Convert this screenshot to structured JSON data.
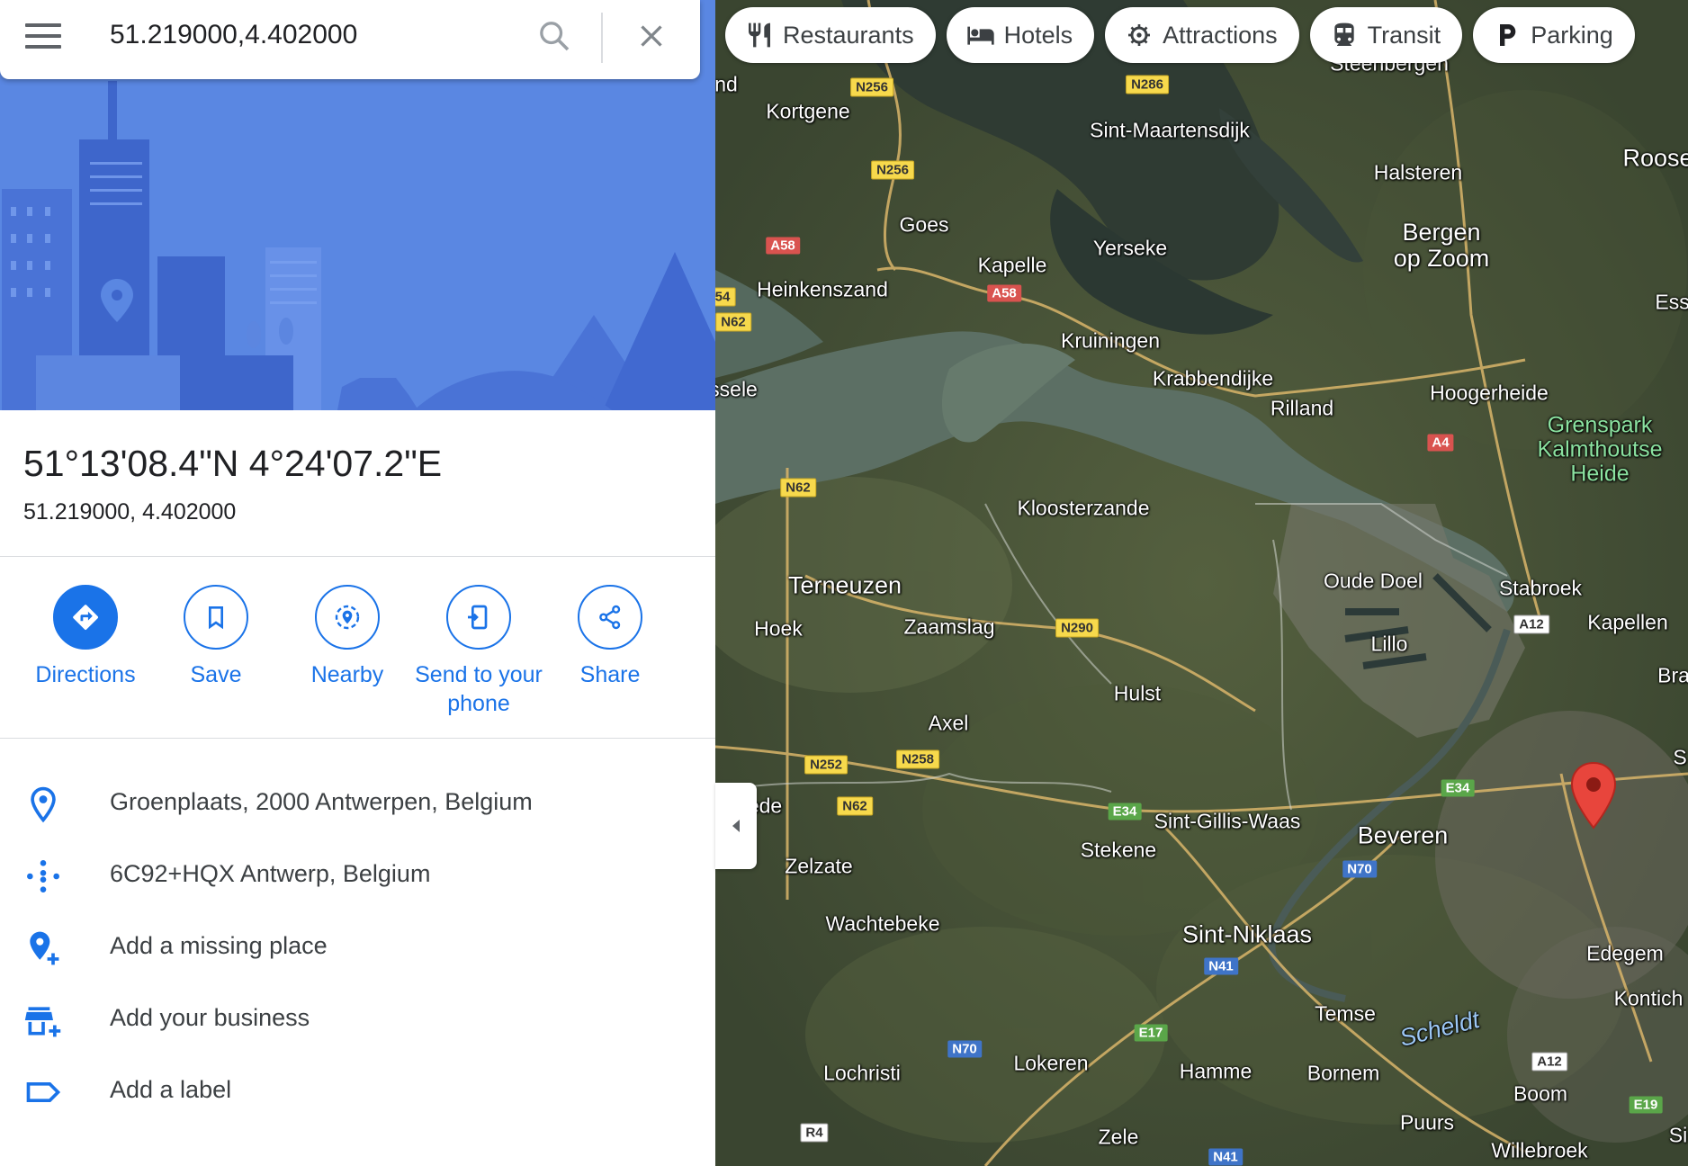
{
  "search": {
    "query": "51.219000,4.402000"
  },
  "place": {
    "title": "51°13'08.4\"N 4°24'07.2\"E",
    "decimal": "51.219000, 4.402000"
  },
  "actions": [
    {
      "label": "Directions",
      "icon": "directions-icon"
    },
    {
      "label": "Save",
      "icon": "bookmark-icon"
    },
    {
      "label": "Nearby",
      "icon": "nearby-icon"
    },
    {
      "label": "Send to your phone",
      "icon": "send-to-phone-icon"
    },
    {
      "label": "Share",
      "icon": "share-icon"
    }
  ],
  "info": [
    {
      "text": "Groenplaats, 2000 Antwerpen, Belgium",
      "icon": "location-pin-icon"
    },
    {
      "text": "6C92+HQX Antwerp, Belgium",
      "icon": "plus-code-icon"
    },
    {
      "text": "Add a missing place",
      "icon": "add-place-icon"
    },
    {
      "text": "Add your business",
      "icon": "add-business-icon"
    },
    {
      "text": "Add a label",
      "icon": "label-icon"
    }
  ],
  "chips": [
    {
      "label": "Restaurants",
      "icon": "restaurant-icon"
    },
    {
      "label": "Hotels",
      "icon": "hotel-icon"
    },
    {
      "label": "Attractions",
      "icon": "attractions-icon"
    },
    {
      "label": "Transit",
      "icon": "transit-icon"
    },
    {
      "label": "Parking",
      "icon": "parking-icon"
    }
  ],
  "colors": {
    "accent": "#1a73e8",
    "hero": "#5a87e2",
    "marker": "#d93025"
  },
  "map": {
    "places": [
      "Kortgene",
      "Sint-Maartensdijk",
      "Halsteren",
      "Roosen",
      "Goes",
      "Yerseke",
      "Bergen op Zoom",
      "Kapelle",
      "Heinkenszand",
      "Esse",
      "Kruiningen",
      "Krabbendijke",
      "Rilland",
      "Hoogerheide",
      "Grenspark Kalmthoutse Heide",
      "ssele",
      "Kloosterzande",
      "Terneuzen",
      "Oude Doel",
      "Stabroek",
      "Hoek",
      "Zaamslag",
      "Lillo",
      "Kapellen",
      "Bra",
      "Hulst",
      "Axel",
      "ede",
      "Sint-Gillis-Waas",
      "Beveren",
      "Stekene",
      "Zelzate",
      "Wachtebeke",
      "Sint-Niklaas",
      "Edegem",
      "Kontich",
      "Temse",
      "Scheldt",
      "Lochristi",
      "Lokeren",
      "Hamme",
      "Bornem",
      "Boom",
      "Puurs",
      "Willebroek",
      "Zele",
      "nd",
      "Steenbergen",
      "S",
      "Si"
    ],
    "roads": [
      "N256",
      "N286",
      "N256",
      "A58",
      "A58",
      "54",
      "N62",
      "A4",
      "N62",
      "N290",
      "A12",
      "N252",
      "N258",
      "N62",
      "E34",
      "E34",
      "N70",
      "N41",
      "E17",
      "N70",
      "A12",
      "E19",
      "R4",
      "N41"
    ]
  }
}
